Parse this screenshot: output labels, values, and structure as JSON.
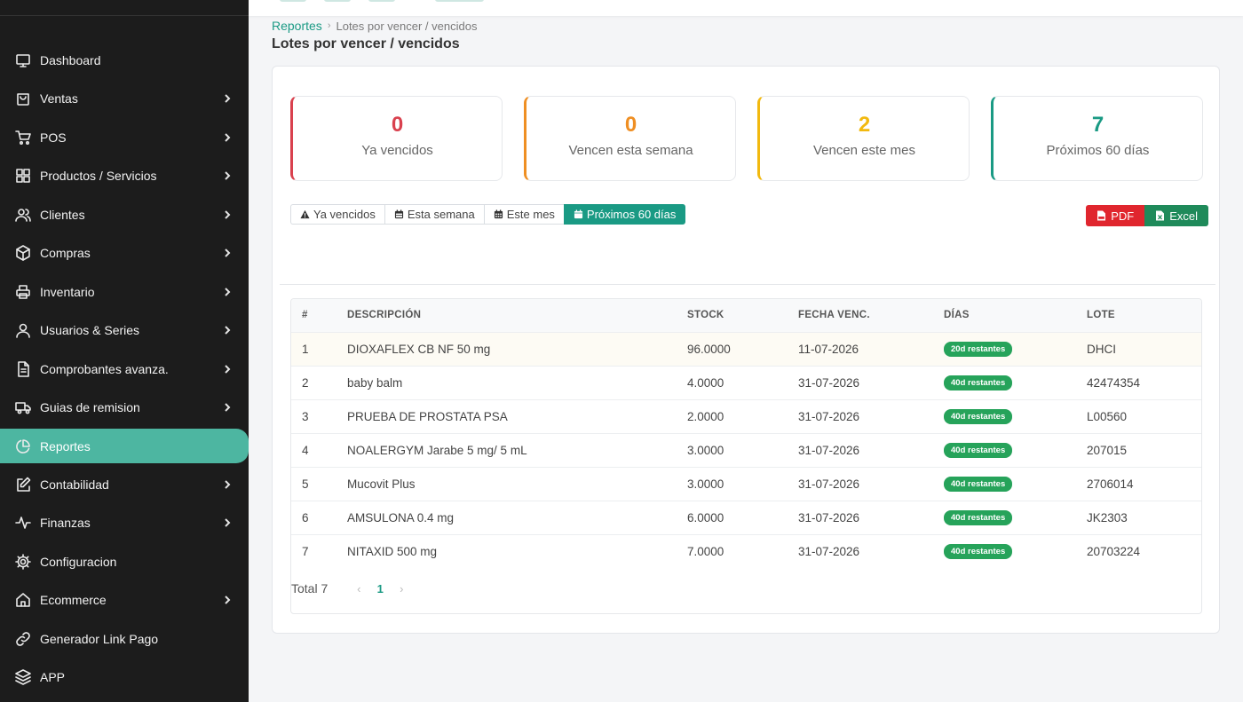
{
  "sidebar": {
    "items": [
      {
        "label": "Dashboard",
        "icon": "monitor-icon",
        "chevron": false
      },
      {
        "label": "Ventas",
        "icon": "shopping-bag-icon",
        "chevron": true
      },
      {
        "label": "POS",
        "icon": "cart-icon",
        "chevron": true
      },
      {
        "label": "Productos / Servicios",
        "icon": "grid-icon",
        "chevron": true
      },
      {
        "label": "Clientes",
        "icon": "users-icon",
        "chevron": true
      },
      {
        "label": "Compras",
        "icon": "box-icon",
        "chevron": true
      },
      {
        "label": "Inventario",
        "icon": "printer-icon",
        "chevron": true
      },
      {
        "label": "Usuarios & Series",
        "icon": "user-icon",
        "chevron": true
      },
      {
        "label": "Comprobantes avanza.",
        "icon": "file-icon",
        "chevron": true
      },
      {
        "label": "Guias de remision",
        "icon": "truck-icon",
        "chevron": true
      },
      {
        "label": "Reportes",
        "icon": "pie-chart-icon",
        "chevron": false,
        "active": true
      },
      {
        "label": "Contabilidad",
        "icon": "edit-icon",
        "chevron": true
      },
      {
        "label": "Finanzas",
        "icon": "activity-icon",
        "chevron": true
      },
      {
        "label": "Configuracion",
        "icon": "settings-icon",
        "chevron": false
      },
      {
        "label": "Ecommerce",
        "icon": "home-icon",
        "chevron": true
      },
      {
        "label": "Generador Link Pago",
        "icon": "link-icon",
        "chevron": false
      },
      {
        "label": "APP",
        "icon": "layers-icon",
        "chevron": false
      }
    ]
  },
  "breadcrumb": {
    "root": "Reportes",
    "separator": "›",
    "current": "Lotes por vencer / vencidos"
  },
  "page_title": "Lotes por vencer / vencidos",
  "stats": [
    {
      "value": "0",
      "label": "Ya vencidos",
      "color": "#d9414e"
    },
    {
      "value": "0",
      "label": "Vencen esta semana",
      "color": "#ef8f23"
    },
    {
      "value": "2",
      "label": "Vencen este mes",
      "color": "#f2b90f"
    },
    {
      "value": "7",
      "label": "Próximos 60 días",
      "color": "#1a9a84"
    }
  ],
  "filters": [
    {
      "label": "Ya vencidos",
      "icon": "warning-icon"
    },
    {
      "label": "Esta semana",
      "icon": "calendar-icon"
    },
    {
      "label": "Este mes",
      "icon": "calendar-grid-icon"
    },
    {
      "label": "Próximos 60 días",
      "icon": "calendar-icon",
      "active": true
    }
  ],
  "exports": {
    "pdf": "PDF",
    "excel": "Excel"
  },
  "table": {
    "headers": [
      "#",
      "DESCRIPCIÓN",
      "STOCK",
      "FECHA VENC.",
      "DÍAS",
      "LOTE"
    ],
    "rows": [
      {
        "n": "1",
        "desc": "DIOXAFLEX CB NF 50 mg",
        "stock": "96.0000",
        "fecha": "11-07-2026",
        "dias": "20d restantes",
        "lote": "DHCI"
      },
      {
        "n": "2",
        "desc": "baby balm",
        "stock": "4.0000",
        "fecha": "31-07-2026",
        "dias": "40d restantes",
        "lote": "42474354"
      },
      {
        "n": "3",
        "desc": "PRUEBA DE PROSTATA PSA",
        "stock": "2.0000",
        "fecha": "31-07-2026",
        "dias": "40d restantes",
        "lote": "L00560"
      },
      {
        "n": "4",
        "desc": "NOALERGYM Jarabe 5 mg/ 5 mL",
        "stock": "3.0000",
        "fecha": "31-07-2026",
        "dias": "40d restantes",
        "lote": "207015"
      },
      {
        "n": "5",
        "desc": "Mucovit Plus",
        "stock": "3.0000",
        "fecha": "31-07-2026",
        "dias": "40d restantes",
        "lote": "2706014"
      },
      {
        "n": "6",
        "desc": "AMSULONA 0.4 mg",
        "stock": "6.0000",
        "fecha": "31-07-2026",
        "dias": "40d restantes",
        "lote": "JK2303"
      },
      {
        "n": "7",
        "desc": "NITAXID 500 mg",
        "stock": "7.0000",
        "fecha": "31-07-2026",
        "dias": "40d restantes",
        "lote": "20703224"
      }
    ]
  },
  "pager": {
    "total": "Total 7",
    "page": "1",
    "prev": "‹",
    "next": "›"
  },
  "colors": {
    "accent": "#1a9a84",
    "sidebar_bg": "#1c1c1c",
    "sidebar_active": "#4db6a1",
    "badge_green": "#26a35a",
    "pdf_red": "#e0262e",
    "excel_green": "#1f8a5a"
  }
}
